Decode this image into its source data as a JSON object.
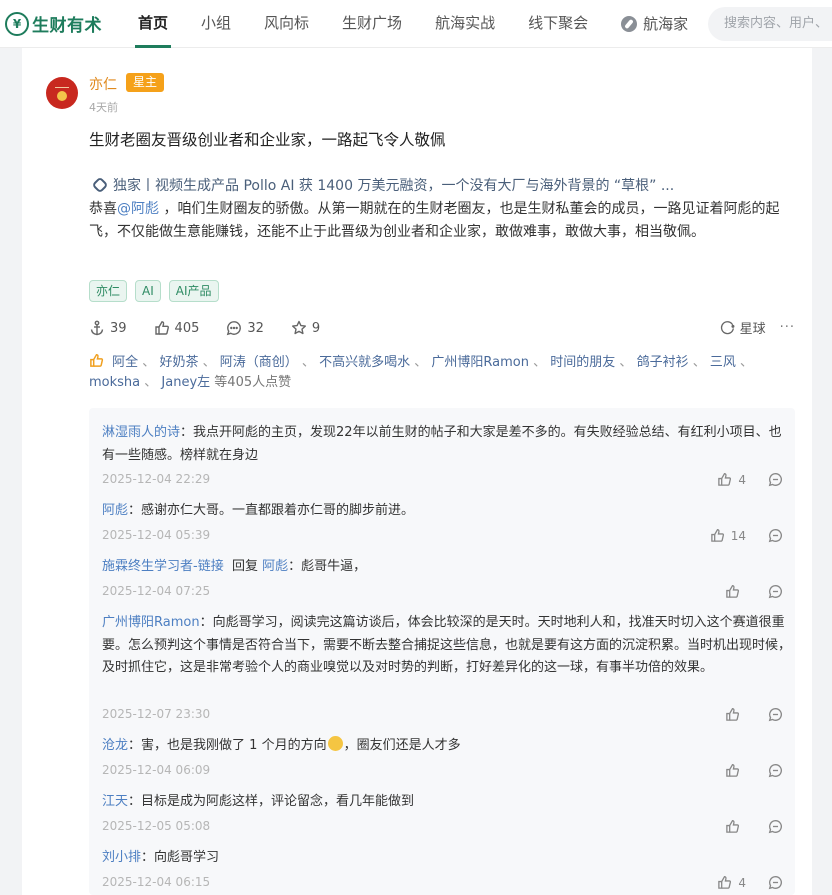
{
  "nav": {
    "logo": "生财有术",
    "items": [
      "首页",
      "小组",
      "风向标",
      "生财广场",
      "航海实战",
      "线下聚会"
    ],
    "hanghai": "航海家",
    "search_placeholder": "搜索内容、用户、"
  },
  "post": {
    "author": "亦仁",
    "badge": "星主",
    "time": "4天前",
    "title": "生财老圈友晋级创业者和企业家，一路起飞令人敬佩",
    "link": "独家丨视频生成产品 Pollo AI 获 1400 万美元融资，一个没有大厂与海外背景的 “草根” ...",
    "body_pre": "恭喜",
    "body_mention": "@阿彪",
    "body_post": " ，咱们生财圈友的骄傲。从第一期就在的生财老圈友，也是生财私董会的成员，一路见证着阿彪的起飞，不仅能做生意能赚钱，还能不止于此晋级为创业者和企业家，敢做难事，敢做大事，相当敬佩。",
    "tags": [
      "亦仁",
      "AI",
      "AI产品"
    ],
    "actions": {
      "anchor": "39",
      "like": "405",
      "comment": "32",
      "star": "9",
      "xingqiu": "星球",
      "more": "···"
    },
    "likers": [
      "阿全",
      "好奶茶",
      "阿涛（商创）",
      "不高兴就多喝水",
      "广州博阳Ramon",
      "时间的朋友",
      "鸽子衬衫",
      "三风",
      "moksha",
      "Janey左"
    ],
    "likers_sep": "、",
    "likers_total": "等405人点赞"
  },
  "comments": [
    {
      "name": "淋湿雨人的诗",
      "text": "我点开阿彪的主页，发现22年以前生财的帖子和大家是差不多的。有失败经验总结、有红利小项目、也有一些随感。榜样就在身边",
      "time": "2025-12-04 22:29",
      "likes": "4"
    },
    {
      "name": "阿彪",
      "text": "感谢亦仁大哥。一直都跟着亦仁哥的脚步前进。",
      "time": "2025-12-04 05:39",
      "likes": "14"
    },
    {
      "name": "施霖终生学习者-链接",
      "reply_word": "回复",
      "reply_to": "阿彪",
      "text": "彪哥牛逼，",
      "time": "2025-12-04 07:25",
      "likes": ""
    },
    {
      "name": "广州博阳Ramon",
      "text": "向彪哥学习，阅读完这篇访谈后，体会比较深的是天时。天时地利人和，找准天时切入这个赛道很重要。怎么预判这个事情是否符合当下，需要不断去整合捕捉这些信息，也就是要有这方面的沉淀积累。当时机出现时候，及时抓住它，这是非常考验个人的商业嗅觉以及对时势的判断，打好差异化的这一球，有事半功倍的效果。",
      "time": "2025-12-07 23:30",
      "likes": ""
    },
    {
      "name": "沧龙",
      "text_pre": "害，也是我刚做了 1 个月的方向",
      "text_post": "，圈友们还是人才多",
      "time": "2025-12-04 06:09",
      "likes": ""
    },
    {
      "name": "江天",
      "text": "目标是成为阿彪这样，评论留念，看几年能做到",
      "time": "2025-12-05 05:08",
      "likes": ""
    },
    {
      "name": "刘小排",
      "text": "向彪哥学习",
      "time": "2025-12-04 06:15",
      "likes": "4"
    }
  ],
  "comment_colon": "："
}
